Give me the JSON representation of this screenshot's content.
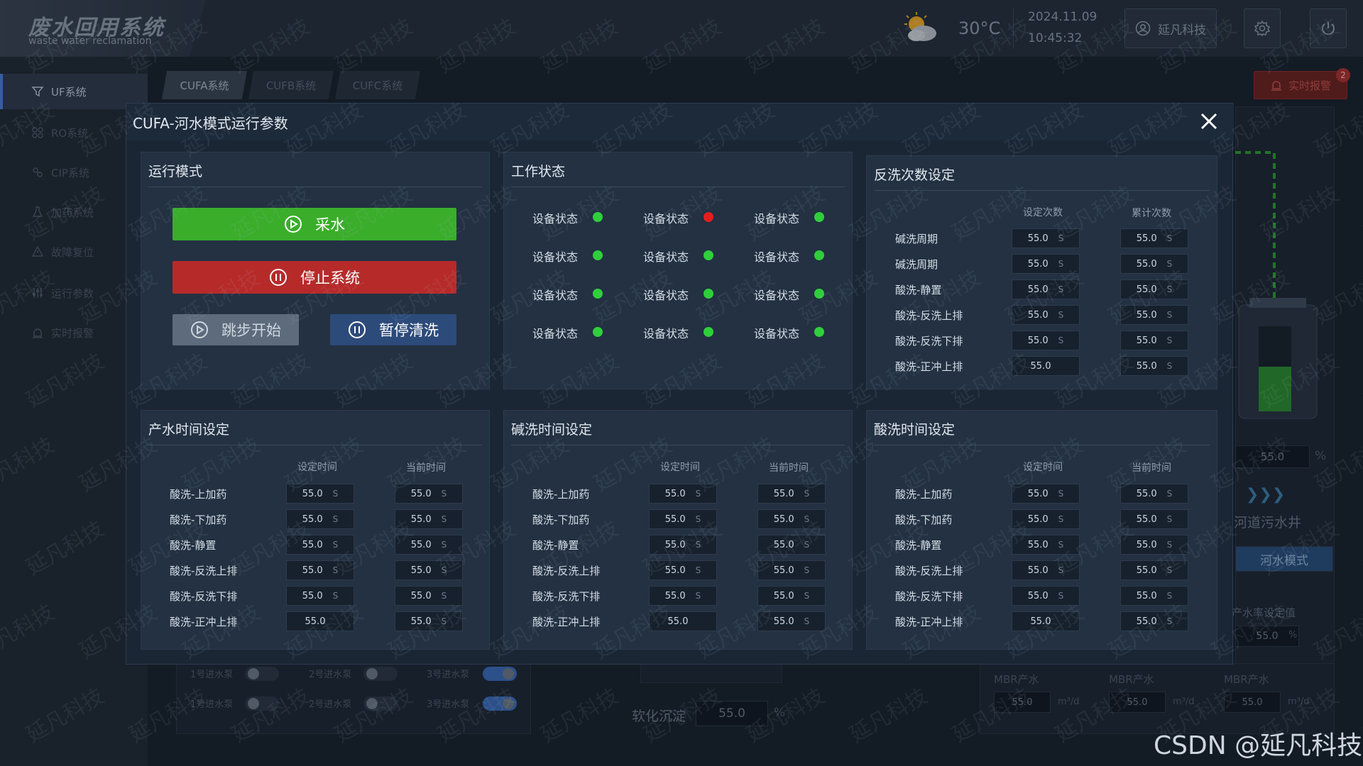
{
  "app": {
    "title": "废水回用系统",
    "subtitle": "waste water reclamation"
  },
  "header": {
    "temperature": "30°C",
    "date": "2024.11.09",
    "time": "10:45:32",
    "user": "延凡科技",
    "weather_icon": "partly-cloudy-icon"
  },
  "sidebar": {
    "items": [
      {
        "label": "UF系统",
        "active": true
      },
      {
        "label": "RO系统"
      },
      {
        "label": "CIP系统"
      },
      {
        "label": "加药系统"
      },
      {
        "label": "故障复位"
      },
      {
        "label": "运行参数"
      },
      {
        "label": "实时报警"
      }
    ]
  },
  "tabs": [
    {
      "label": "CUFA系统"
    },
    {
      "label": "CUFB系统"
    },
    {
      "label": "CUFC系统"
    }
  ],
  "alarm": {
    "label": "实时报警",
    "count": "2"
  },
  "background": {
    "tank_value": "55.0",
    "tank_unit": "%",
    "sewer_label": "河道污水井",
    "mode_btn": "河水模式",
    "rate_label": "产水率设定值",
    "rate_value": "55.0",
    "rate_unit": "%",
    "pumps_row1": [
      "1号进水泵",
      "2号进水泵",
      "3号进水泵"
    ],
    "pumps_row2": [
      "1号进水泵",
      "2号进水泵",
      "3号进水泵"
    ],
    "soft_label": "软化沉淀",
    "soft_value": "55.0",
    "soft_unit": "%",
    "mbr": [
      {
        "label": "MBR产水",
        "value": "55.0",
        "unit": "m³/d"
      },
      {
        "label": "MBR产水",
        "value": "55.0",
        "unit": "m³/d"
      },
      {
        "label": "MBR产水",
        "value": "55.0",
        "unit": "m³/d"
      }
    ]
  },
  "modal": {
    "title": "CUFA-河水模式运行参数",
    "run_mode": {
      "title": "运行模式",
      "btn_collect": "采水",
      "btn_stop": "停止系统",
      "btn_step": "跳步开始",
      "btn_pause": "暂停清洗"
    },
    "work_status": {
      "title": "工作状态",
      "label": "设备状态",
      "rows": [
        [
          "green",
          "red",
          "green"
        ],
        [
          "green",
          "green",
          "green"
        ],
        [
          "green",
          "green",
          "green"
        ],
        [
          "green",
          "green",
          "green"
        ]
      ]
    },
    "backwash": {
      "title": "反洗次数设定",
      "col1": "设定次数",
      "col2": "累计次数",
      "rows": [
        {
          "label": "碱洗周期",
          "v1": "55.0",
          "v2": "55.0",
          "u1": "S",
          "u2": "S"
        },
        {
          "label": "碱洗周期",
          "v1": "55.0",
          "v2": "55.0",
          "u1": "S",
          "u2": "S"
        },
        {
          "label": "酸洗-静置",
          "v1": "55.0",
          "v2": "55.0",
          "u1": "S",
          "u2": "S"
        },
        {
          "label": "酸洗-反洗上排",
          "v1": "55.0",
          "v2": "55.0",
          "u1": "S",
          "u2": "S"
        },
        {
          "label": "酸洗-反洗下排",
          "v1": "55.0",
          "v2": "55.0",
          "u1": "S",
          "u2": "S"
        },
        {
          "label": "酸洗-正冲上排",
          "v1": "55.0",
          "v2": "55.0",
          "u1": "",
          "u2": "S"
        }
      ]
    },
    "time_cards": [
      {
        "title": "产水时间设定"
      },
      {
        "title": "碱洗时间设定"
      },
      {
        "title": "酸洗时间设定"
      }
    ],
    "time_cols": {
      "col1": "设定时间",
      "col2": "当前时间"
    },
    "time_rows": [
      {
        "label": "酸洗-上加药",
        "v1": "55.0",
        "v2": "55.0",
        "u1": "S",
        "u2": "S"
      },
      {
        "label": "酸洗-下加药",
        "v1": "55.0",
        "v2": "55.0",
        "u1": "S",
        "u2": "S"
      },
      {
        "label": "酸洗-静置",
        "v1": "55.0",
        "v2": "55.0",
        "u1": "S",
        "u2": "S"
      },
      {
        "label": "酸洗-反洗上排",
        "v1": "55.0",
        "v2": "55.0",
        "u1": "S",
        "u2": "S"
      },
      {
        "label": "酸洗-反洗下排",
        "v1": "55.0",
        "v2": "55.0",
        "u1": "S",
        "u2": "S"
      },
      {
        "label": "酸洗-正冲上排",
        "v1": "55.0",
        "v2": "55.0",
        "u1": "",
        "u2": "S"
      }
    ]
  },
  "watermark": {
    "text": "延凡科技",
    "csdn": "CSDN @延凡科技"
  },
  "colors": {
    "green": "#2fcf3c",
    "red": "#e41e1e",
    "btn_green": "#3aad2b",
    "btn_red": "#b72a2a",
    "btn_gray": "#5d6b7c",
    "btn_blue": "#2d4b7a"
  }
}
